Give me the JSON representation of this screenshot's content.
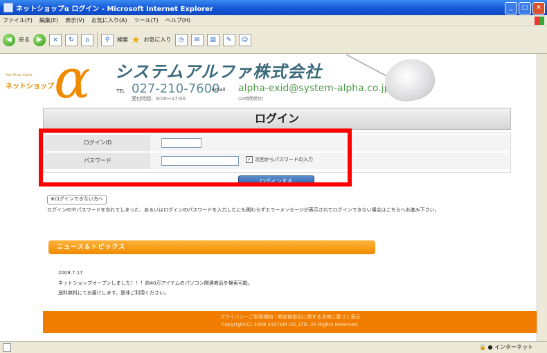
{
  "window": {
    "title": "ネットショップα ログイン - Microsoft Internet Explorer",
    "controls": [
      "_",
      "□",
      "×"
    ]
  },
  "menu": [
    "ファイル(F)",
    "編集(E)",
    "表示(V)",
    "お気に入り(A)",
    "ツール(T)",
    "ヘルプ(H)"
  ],
  "toolbar": {
    "back_label": "戻る",
    "search_label": "検索",
    "favorites_label": "お気に入り"
  },
  "header": {
    "logo_tagline": "Net Shop Alpha",
    "logo_text": "ネットショップ",
    "logo_mark": "α",
    "company_name": "システムアルファ株式会社",
    "tel_label": "TEL",
    "tel": "027-210-7600",
    "hours": "受付時間：9:00〜17:00",
    "email_label": "Email",
    "email": "alpha-exid@system-alpha.co.jp",
    "email_sub": "(24時間受付)"
  },
  "login": {
    "title": "ログイン",
    "id_label": "ログインID",
    "id_value": "",
    "password_label": "パスワード",
    "password_value": "",
    "remember_label": "次回からパスワードの入力",
    "remember_checked": true,
    "submit_label": "ログインする"
  },
  "help": {
    "link_label": "ログインできない方へ",
    "text": "ログインIDやパスワードを忘れてしまった、あるいはログインIDパスワードを入力したにも関わらずエラーメッセージが表示されてログインできない場合はこちらへお進み下さい。"
  },
  "news": {
    "title": "ニュース＆トピックス",
    "date": "2008.7.17",
    "lines": [
      "ネットショップオープンしました！！！約40万アイテムのパソコン関連商品を検索可能。",
      "送料無料にてお届けします。是非ご利用ください。"
    ]
  },
  "footer": {
    "links": "プライバシーご利用規約｜特定商取引に関する法律に基づく表示",
    "copyright": "Copyright(C) 2008 SYSTEM CO.,LTD. All Rights Reserved."
  },
  "status": {
    "zone": "インターネット"
  }
}
